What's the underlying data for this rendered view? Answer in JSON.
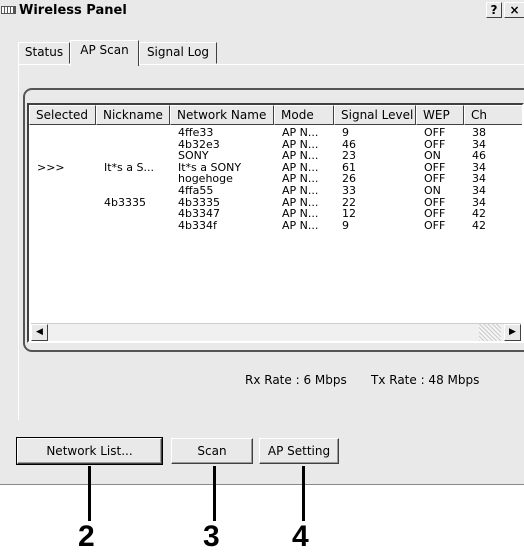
{
  "window": {
    "title": "Wireless Panel",
    "help_label": "?",
    "close_label": "×"
  },
  "tabs": [
    {
      "label": "Status",
      "active": false
    },
    {
      "label": "AP Scan",
      "active": true
    },
    {
      "label": "Signal Log",
      "active": false
    }
  ],
  "scan_list": {
    "columns": [
      "Selected",
      "Nickname",
      "Network Name",
      "Mode",
      "Signal Level",
      "WEP",
      "Ch"
    ],
    "rows": [
      {
        "selected": "",
        "nickname": "",
        "network": "4ffe33",
        "mode": "AP N...",
        "signal": "9",
        "wep": "OFF",
        "ch": "38"
      },
      {
        "selected": "",
        "nickname": "",
        "network": "4b32e3",
        "mode": "AP N...",
        "signal": "46",
        "wep": "OFF",
        "ch": "34"
      },
      {
        "selected": "",
        "nickname": "",
        "network": "SONY",
        "mode": "AP N...",
        "signal": "23",
        "wep": "ON",
        "ch": "46"
      },
      {
        "selected": ">>>",
        "nickname": "It*s a S...",
        "network": "It*s a SONY",
        "mode": "AP N...",
        "signal": "61",
        "wep": "OFF",
        "ch": "34"
      },
      {
        "selected": "",
        "nickname": "",
        "network": "hogehoge",
        "mode": "AP N...",
        "signal": "26",
        "wep": "OFF",
        "ch": "34"
      },
      {
        "selected": "",
        "nickname": "",
        "network": "4ffa55",
        "mode": "AP N...",
        "signal": "33",
        "wep": "ON",
        "ch": "34"
      },
      {
        "selected": "",
        "nickname": "4b3335",
        "network": "4b3335",
        "mode": "AP N...",
        "signal": "22",
        "wep": "OFF",
        "ch": "34"
      },
      {
        "selected": "",
        "nickname": "",
        "network": "4b3347",
        "mode": "AP N...",
        "signal": "12",
        "wep": "OFF",
        "ch": "42"
      },
      {
        "selected": "",
        "nickname": "",
        "network": "4b334f",
        "mode": "AP N...",
        "signal": "9",
        "wep": "OFF",
        "ch": "42"
      }
    ],
    "scroll_left_icon": "arrow-left-icon",
    "scroll_right_icon": "arrow-right-icon"
  },
  "rates": {
    "rx": "Rx Rate : 6 Mbps",
    "tx": "Tx Rate : 48 Mbps"
  },
  "buttons": {
    "network_list": "Network List...",
    "scan": "Scan",
    "ap_setting": "AP Setting"
  },
  "callouts": [
    "2",
    "3",
    "4"
  ]
}
